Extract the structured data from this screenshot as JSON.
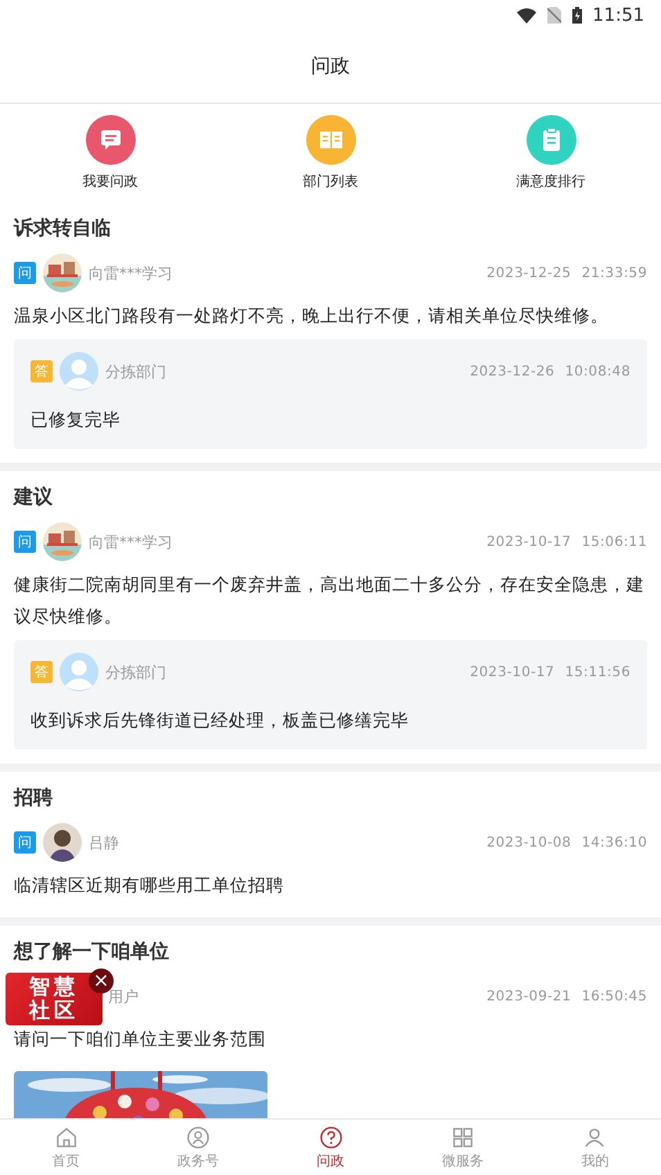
{
  "status_bar": {
    "time": "11:51"
  },
  "title": "问政",
  "quick_actions": [
    {
      "label": "我要问政",
      "kind": "message",
      "color": "#e8576b"
    },
    {
      "label": "部门列表",
      "kind": "book",
      "color": "#f7b533"
    },
    {
      "label": "满意度排行",
      "kind": "clipboard",
      "color": "#2fd3c0"
    }
  ],
  "posts": [
    {
      "category": "诉求转自临",
      "question": {
        "tag": "问",
        "avatar": {
          "kind": "landscape"
        },
        "author": "向雷***学习",
        "time": "2023-12-25 21:33:59",
        "text": "温泉小区北门路段有一处路灯不亮，晚上出行不便，请相关单位尽快维修。"
      },
      "answer": {
        "tag": "答",
        "avatar": {
          "kind": "default"
        },
        "author": "分拣部门",
        "time": "2023-12-26 10:08:48",
        "text": "已修复完毕"
      }
    },
    {
      "category": "建议",
      "question": {
        "tag": "问",
        "avatar": {
          "kind": "landscape"
        },
        "author": "向雷***学习",
        "time": "2023-10-17 15:06:11",
        "text": "健康街二院南胡同里有一个废弃井盖，高出地面二十多公分，存在安全隐患，建议尽快维修。"
      },
      "answer": {
        "tag": "答",
        "avatar": {
          "kind": "default"
        },
        "author": "分拣部门",
        "time": "2023-10-17 15:11:56",
        "text": "收到诉求后先锋街道已经处理，板盖已修缮完毕"
      }
    },
    {
      "category": "招聘",
      "question": {
        "tag": "问",
        "avatar": {
          "kind": "person"
        },
        "author": "吕静",
        "time": "2023-10-08 14:36:10",
        "text": "临清辖区近期有哪些用工单位招聘"
      }
    },
    {
      "category": "想了解一下咱单位",
      "question": {
        "author": "用户",
        "time": "2023-09-21 16:50:45",
        "text": "请问一下咱们单位主要业务范围"
      }
    }
  ],
  "floating_badge": {
    "line1": "智慧",
    "line2": "社区",
    "close": "×"
  },
  "tab_bar": [
    {
      "label": "首页",
      "kind": "home",
      "selected": false
    },
    {
      "label": "政务号",
      "kind": "person",
      "selected": false
    },
    {
      "label": "问政",
      "kind": "question",
      "selected": true
    },
    {
      "label": "微服务",
      "kind": "grid",
      "selected": false
    },
    {
      "label": "我的",
      "kind": "user",
      "selected": false
    }
  ]
}
